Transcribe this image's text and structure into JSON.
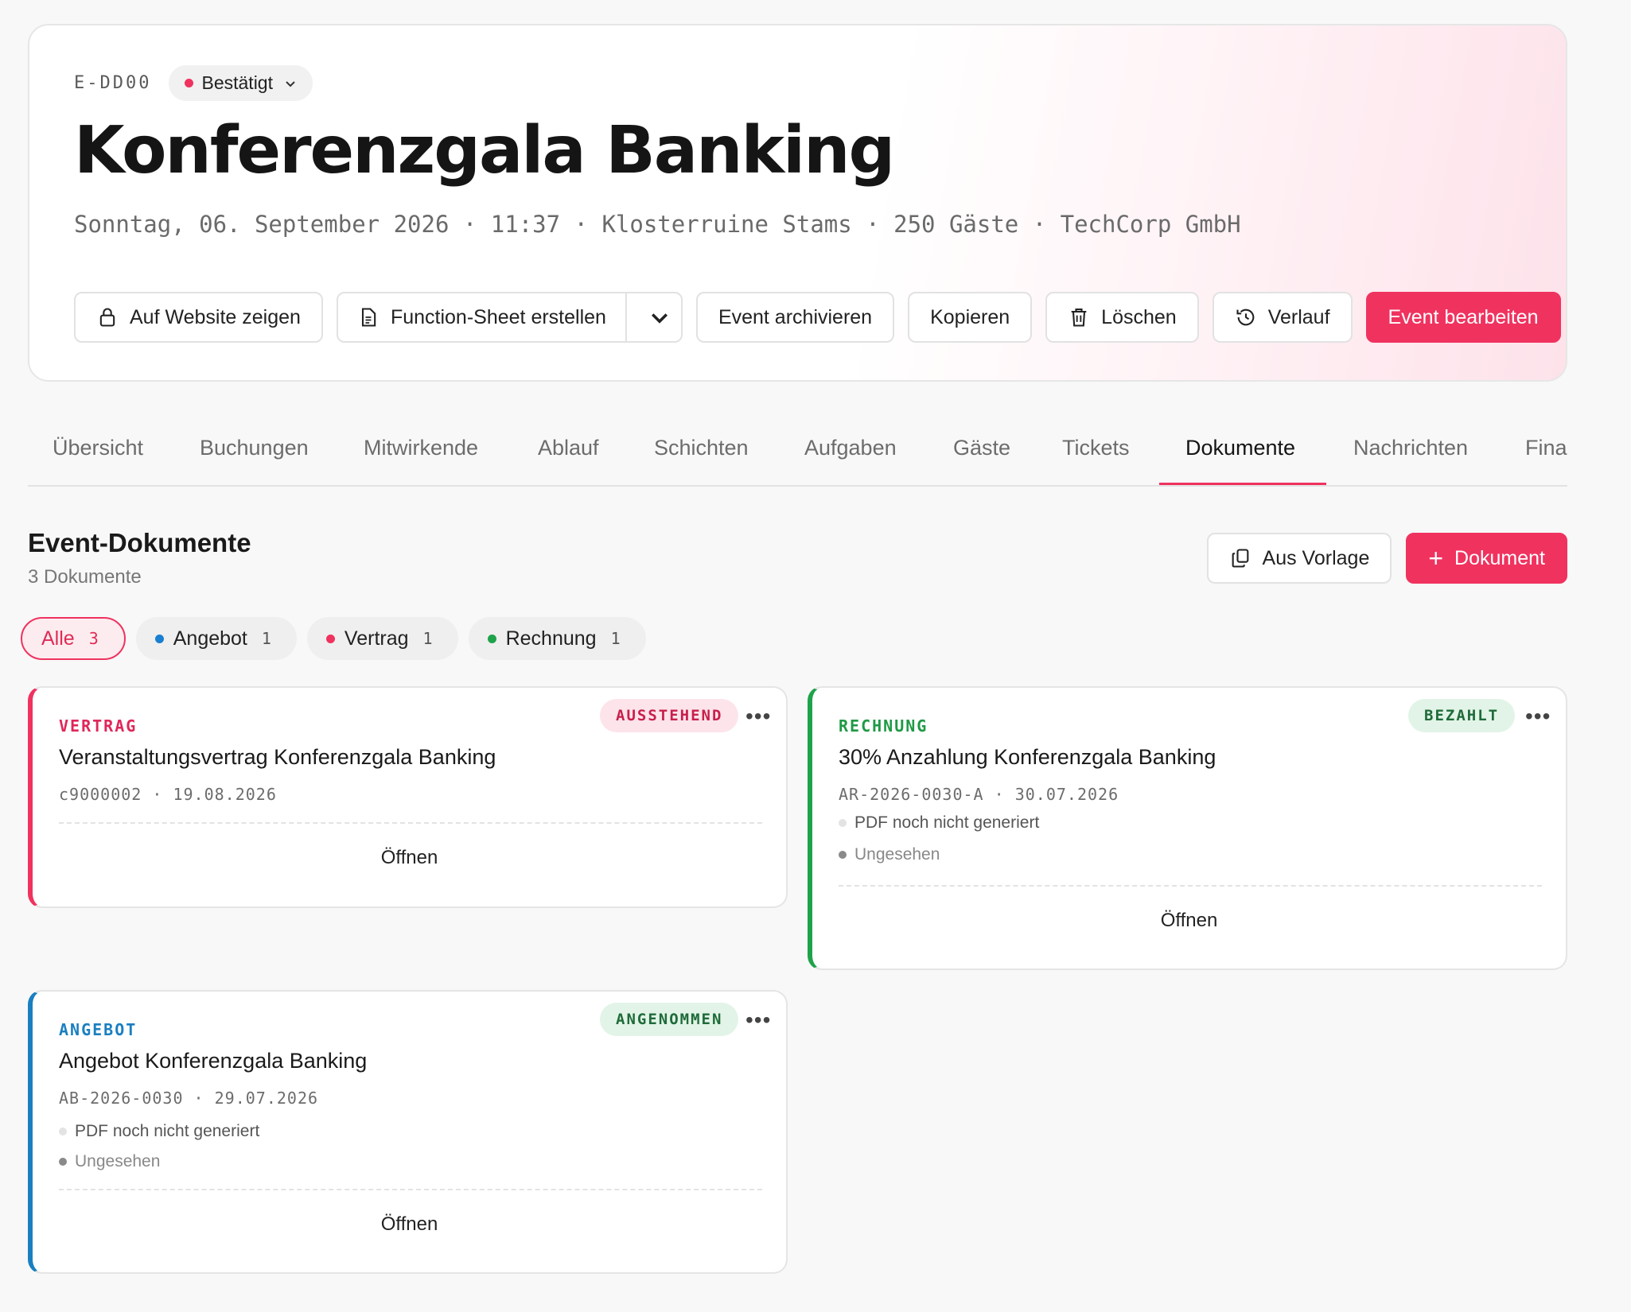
{
  "event": {
    "id": "E-DD00",
    "status": "Bestätigt",
    "status_color": "#f0325f",
    "title": "Konferenzgala Banking",
    "meta": "Sonntag, 06. September 2026 · 11:37 · Klosterruine Stams · 250 Gäste · TechCorp GmbH"
  },
  "actions": {
    "website": "Auf Website zeigen",
    "function_sheet": "Function-Sheet erstellen",
    "archive": "Event archivieren",
    "copy": "Kopieren",
    "delete": "Löschen",
    "history": "Verlauf",
    "edit": "Event bearbeiten"
  },
  "tabs": [
    "Übersicht",
    "Buchungen",
    "Mitwirkende",
    "Ablauf",
    "Schichten",
    "Aufgaben",
    "Gäste",
    "Tickets",
    "Dokumente",
    "Nachrichten",
    "Finanzen"
  ],
  "active_tab": "Dokumente",
  "section": {
    "title": "Event-Dokumente",
    "subtitle": "3 Dokumente",
    "from_template": "Aus Vorlage",
    "add_document": "Dokument"
  },
  "filters": [
    {
      "label": "Alle",
      "count": "3",
      "color": ""
    },
    {
      "label": "Angebot",
      "count": "1",
      "color": "#1a7fd0"
    },
    {
      "label": "Vertrag",
      "count": "1",
      "color": "#f0325f"
    },
    {
      "label": "Rechnung",
      "count": "1",
      "color": "#1ea34a"
    }
  ],
  "documents": [
    {
      "type": "VERTRAG",
      "type_color": "#e0275a",
      "name": "Veranstaltungsvertrag Konferenzgala Banking",
      "meta": "c9000002 · 19.08.2026",
      "badge": "AUSSTEHEND",
      "badge_fg": "#c81f4c",
      "badge_bg": "#fde4ea",
      "open": "Öffnen"
    },
    {
      "type": "RECHNUNG",
      "type_color": "#1e9a45",
      "name": "30% Anzahlung Konferenzgala Banking",
      "meta": "AR-2026-0030-A · 30.07.2026",
      "badge": "BEZAHLT",
      "badge_fg": "#1f6b3a",
      "badge_bg": "#e2f4e7",
      "pdf_status": "PDF noch nicht generiert",
      "seen_status": "Ungesehen",
      "open": "Öffnen"
    },
    {
      "type": "ANGEBOT",
      "type_color": "#1a7fc0",
      "name": "Angebot Konferenzgala Banking",
      "meta": "AB-2026-0030 · 29.07.2026",
      "badge": "ANGENOMMEN",
      "badge_fg": "#1f6b3a",
      "badge_bg": "#e2f4e7",
      "pdf_status": "PDF noch nicht generiert",
      "seen_status": "Ungesehen",
      "open": "Öffnen"
    }
  ],
  "more_glyph": "•••",
  "plus_glyph": "+"
}
